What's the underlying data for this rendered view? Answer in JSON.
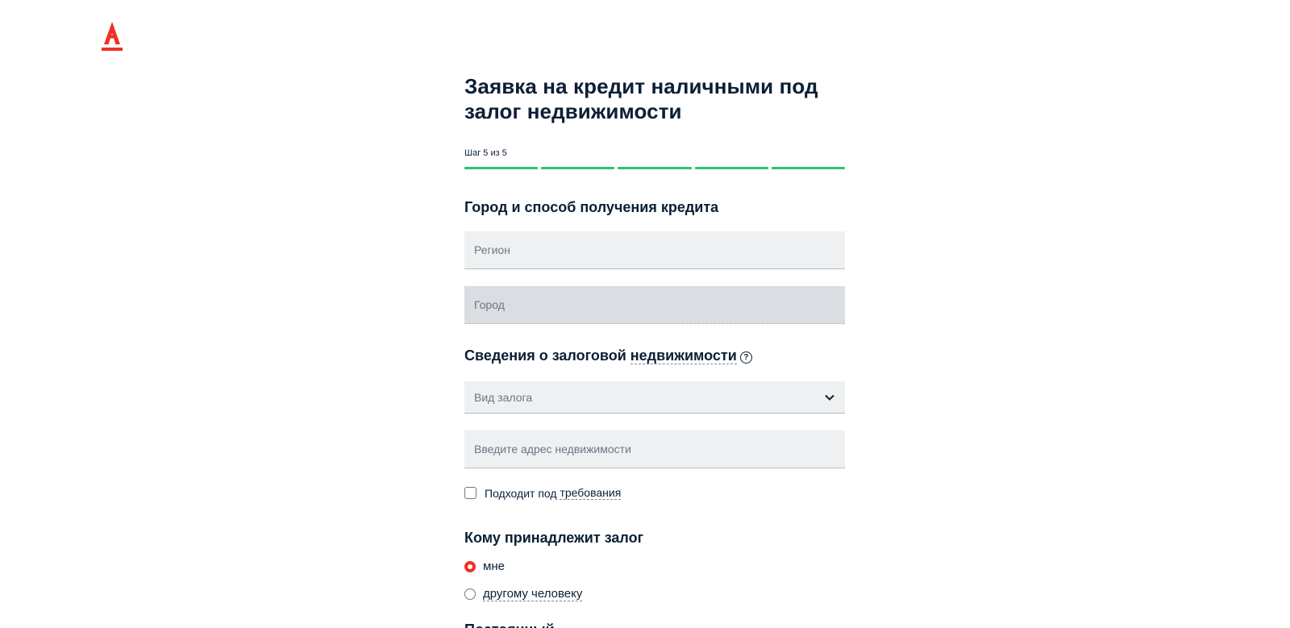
{
  "logo": {
    "icon": "alfa-bank-logo-icon",
    "color": "#ef3124"
  },
  "header": {
    "title": "Заявка на кредит наличными под залог недвижимости",
    "step_label": "Шаг 5 из 5",
    "progress": {
      "completed_steps": 5,
      "total_steps": 5,
      "color": "#2fc26b"
    }
  },
  "city_section": {
    "title": "Город и способ получения кредита",
    "region_placeholder": "Регион",
    "city_placeholder": "Город"
  },
  "property_section": {
    "title_prefix": "Сведения о залоговой ",
    "title_link": "недвижимости",
    "help_icon": "question-circle-icon",
    "collateral_type_placeholder": "Вид залога",
    "collateral_chevron_icon": "chevron-down-icon",
    "address_placeholder": "Введите адрес недвижимости",
    "requirements_checkbox_prefix": "Подходит под ",
    "requirements_link": "требования"
  },
  "owner_section": {
    "title": "Кому принадлежит залог",
    "options": [
      {
        "label": "мне",
        "selected": true
      },
      {
        "label": "другому человеку",
        "selected": false
      }
    ],
    "accent_color": "#ef3124"
  },
  "next_section": {
    "title": "Постоянный"
  }
}
